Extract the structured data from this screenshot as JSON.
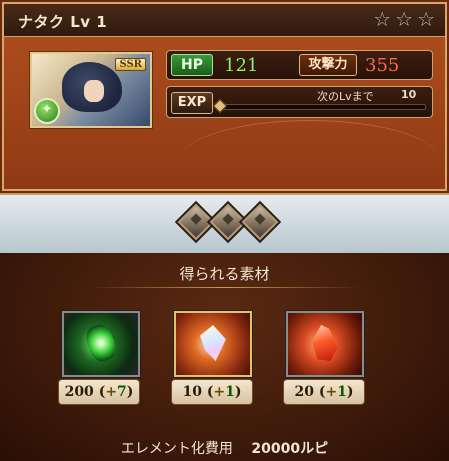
{
  "header": {
    "title": "ナタク Lv 1",
    "stars": [
      "☆",
      "☆",
      "☆"
    ]
  },
  "portrait": {
    "rarity": "SSR",
    "element_icon": "wind-element-icon"
  },
  "stats": {
    "hp_label": "HP",
    "hp_value": "121",
    "attack_label": "攻撃力",
    "attack_value": "355",
    "exp_label": "EXP",
    "next_level_label": "次のLvまで",
    "next_level_value": "10",
    "exp_progress": 0
  },
  "materials": {
    "title": "得られる素材",
    "items": [
      {
        "icon": "green-wind-quartz-icon",
        "base": "200",
        "open": "(",
        "plus": "+",
        "bonus": "7",
        "close": ")"
      },
      {
        "icon": "crystal-shard-icon",
        "base": "10",
        "open": "(",
        "plus": "+",
        "bonus": "1",
        "close": ")"
      },
      {
        "icon": "fire-quartz-icon",
        "base": "20",
        "open": "(",
        "plus": "+",
        "bonus": "1",
        "close": ")"
      }
    ]
  },
  "cost": {
    "label": "エレメント化費用",
    "value": "20000ルピ"
  },
  "colors": {
    "hp_value": "#8ff06a",
    "attack_value": "#ff6a4a",
    "card_bg": "#a3461a",
    "band_bg": "#cfd9de"
  }
}
